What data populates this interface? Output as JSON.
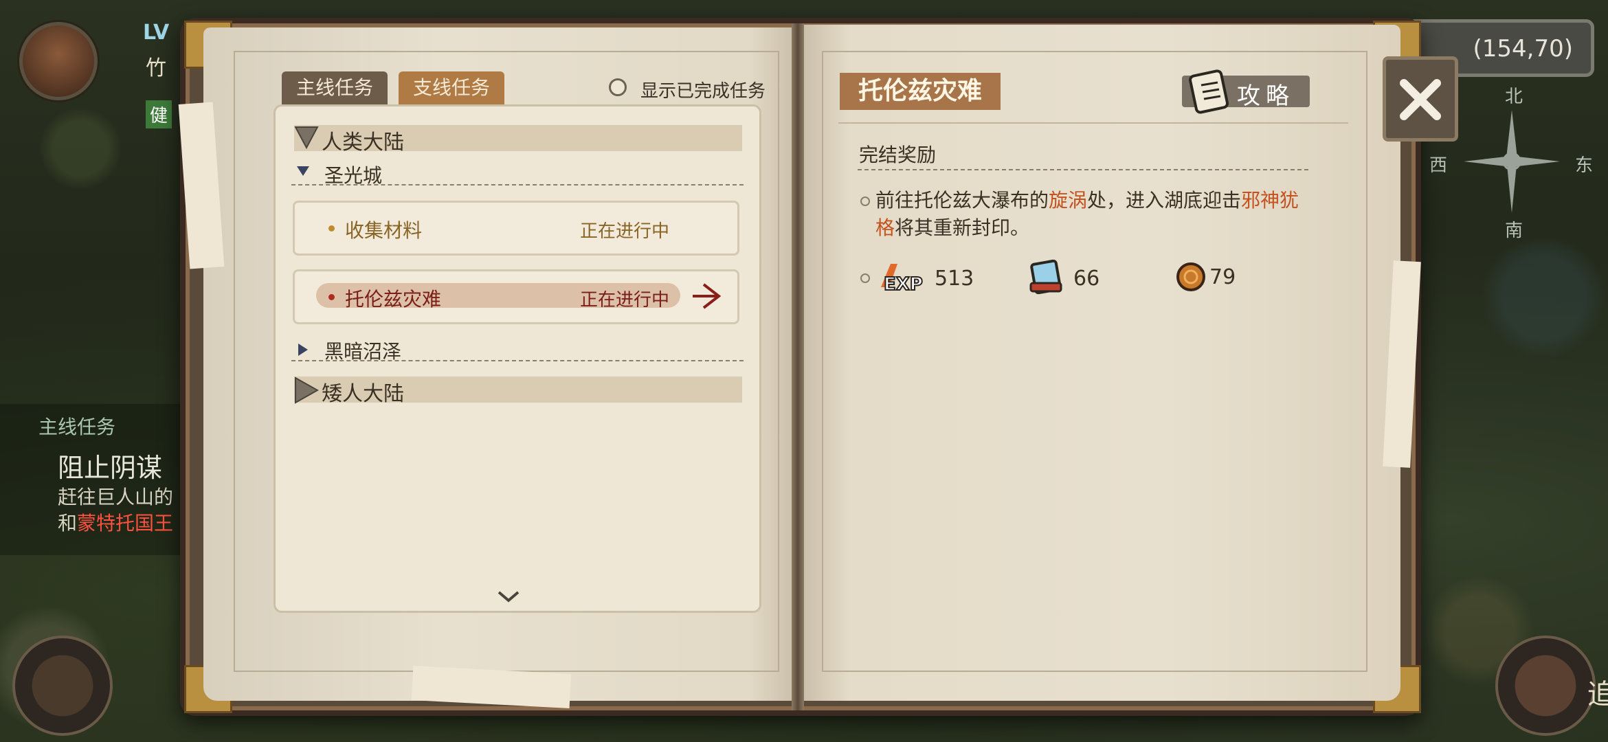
{
  "hud": {
    "level_label": "LV",
    "player_name_partial": "竹",
    "health_partial": "健",
    "coordinates": "(154,70)",
    "compass": {
      "north": "北",
      "west": "西",
      "east": "东",
      "south": "南"
    },
    "side_quest_panel": {
      "title": "主线任务",
      "quest_name": "阻止阴谋",
      "desc_line1": "赶往巨人山的",
      "desc_line2_prefix": "和",
      "desc_line2_red": "蒙特托国王"
    },
    "bottom_right_label_partial": "追"
  },
  "book": {
    "tabs": [
      {
        "label": "主线任务",
        "active": false
      },
      {
        "label": "支线任务",
        "active": true
      }
    ],
    "show_completed_label": "显示已完成任务",
    "regions": [
      {
        "name": "人类大陆",
        "expanded": true,
        "subregions": [
          {
            "name": "圣光城",
            "expanded": true,
            "quests": [
              {
                "name": "收集材料",
                "status": "正在进行中",
                "selected": false
              },
              {
                "name": "托伦兹灾难",
                "status": "正在进行中",
                "selected": true
              }
            ]
          },
          {
            "name": "黑暗沼泽",
            "expanded": false,
            "quests": []
          }
        ]
      },
      {
        "name": "矮人大陆",
        "expanded": false,
        "subregions": []
      }
    ],
    "detail": {
      "title": "托伦兹灾难",
      "guide_button_label": "攻略",
      "rewards_heading": "完结奖励",
      "description": {
        "p1": "前往托伦兹大瀑布的",
        "h1": "旋涡",
        "p2": "处，进入湖底迎击",
        "h2": "邪神犹格",
        "p3": "将其重新封印。"
      },
      "rewards": [
        {
          "icon": "exp-icon",
          "value": "513"
        },
        {
          "icon": "skill-book-icon",
          "value": "66"
        },
        {
          "icon": "gold-coin-icon",
          "value": "79"
        }
      ]
    }
  },
  "colors": {
    "active_tab": "#b07a45",
    "inactive_tab": "#6e5c4a",
    "highlight_text": "#c4521e",
    "selected_quest_text": "#7a1e16",
    "in_progress_text": "#8a6424",
    "title_bg": "#a8744a"
  }
}
